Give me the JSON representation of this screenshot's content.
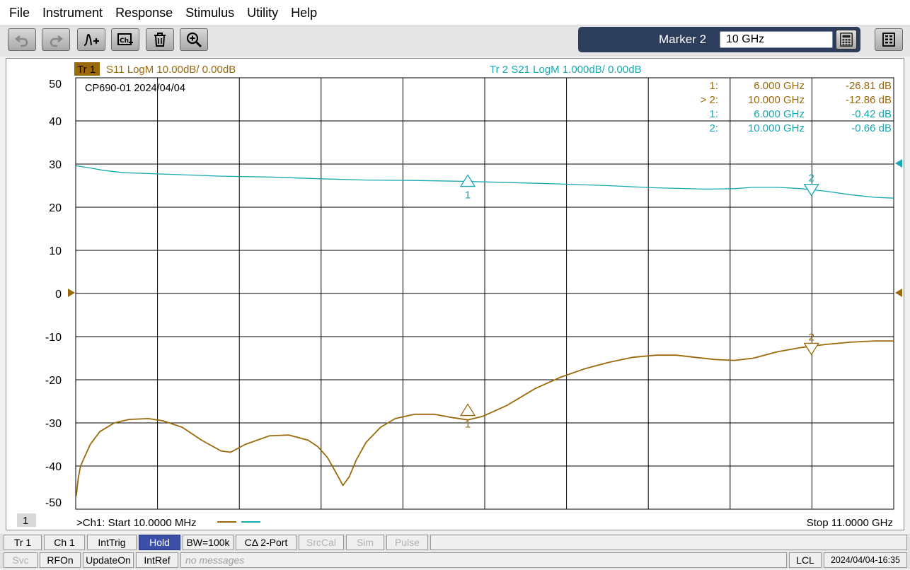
{
  "menu": [
    "File",
    "Instrument",
    "Response",
    "Stimulus",
    "Utility",
    "Help"
  ],
  "toolbar": {
    "buttons": [
      {
        "name": "undo-button",
        "icon": "undo-icon"
      },
      {
        "name": "redo-button",
        "icon": "redo-icon"
      },
      {
        "name": "add-trace-button",
        "icon": "add-trace-icon"
      },
      {
        "name": "add-channel-button",
        "icon": "add-channel-icon"
      },
      {
        "name": "delete-button",
        "icon": "trash-icon"
      },
      {
        "name": "zoom-button",
        "icon": "zoom-in-icon"
      }
    ],
    "marker_label": "Marker 2",
    "marker_value": "10 GHz",
    "keypad_icon": "calculator-icon",
    "menu_icon": "grid-menu-icon"
  },
  "colors": {
    "trace1": "#9a6a0a",
    "trace2": "#18a8b0",
    "grid": "#000000",
    "label_bg": "#9a6a0a"
  },
  "header": {
    "tr1_label": "Tr 1",
    "tr1_text": "S11 LogM 10.00dB/  0.00dB",
    "tr2_text": "Tr  2   S21 LogM 1.000dB/  0.00dB"
  },
  "annotation": "CP690-01  2024/04/04",
  "marker_table": [
    {
      "trace": 1,
      "id": "1:",
      "freq": "6.000  GHz",
      "val": "-26.81 dB"
    },
    {
      "trace": 1,
      "id": "> 2:",
      "freq": "10.000  GHz",
      "val": "-12.86 dB"
    },
    {
      "trace": 2,
      "id": "1:",
      "freq": "6.000  GHz",
      "val": "-0.42 dB"
    },
    {
      "trace": 2,
      "id": "2:",
      "freq": "10.000  GHz",
      "val": "-0.66 dB"
    }
  ],
  "footer": {
    "channel_number": "1",
    "start_text": ">Ch1:  Start   10.0000 MHz",
    "stop_text": "Stop  11.0000 GHz"
  },
  "chart_data": {
    "type": "line",
    "x_range_ghz": [
      0.01,
      11.0
    ],
    "x_divisions": 10,
    "y_ticks": [
      50,
      40,
      30,
      20,
      10,
      0,
      -10,
      -20,
      -30,
      -40,
      -50
    ],
    "y_range_db": [
      -50,
      50
    ],
    "grid": true,
    "series": [
      {
        "name": "S11 LogM",
        "scale_db_per_div": 10,
        "ref_db": 0,
        "points": [
          [
            0.01,
            -47
          ],
          [
            0.05,
            -43
          ],
          [
            0.1,
            -40
          ],
          [
            0.3,
            -35
          ],
          [
            0.5,
            -32
          ],
          [
            0.8,
            -30
          ],
          [
            1.1,
            -29.2
          ],
          [
            1.5,
            -29.0
          ],
          [
            1.8,
            -29.5
          ],
          [
            2.2,
            -31
          ],
          [
            2.6,
            -34
          ],
          [
            3.0,
            -36.5
          ],
          [
            3.2,
            -36.8
          ],
          [
            3.5,
            -35
          ],
          [
            4.0,
            -33
          ],
          [
            4.4,
            -32.8
          ],
          [
            4.8,
            -34
          ],
          [
            5.0,
            -35.5
          ],
          [
            5.2,
            -38
          ],
          [
            5.4,
            -42
          ],
          [
            5.52,
            -44.5
          ],
          [
            5.65,
            -42.5
          ],
          [
            5.8,
            -38.5
          ],
          [
            6.0,
            -34.5
          ],
          [
            6.3,
            -31
          ],
          [
            6.6,
            -29
          ],
          [
            7.0,
            -28
          ],
          [
            7.4,
            -28
          ],
          [
            7.8,
            -28.8
          ],
          [
            8.1,
            -29.3
          ],
          [
            8.4,
            -28.5
          ],
          [
            8.9,
            -26
          ],
          [
            9.5,
            -22
          ],
          [
            10.0,
            -19.5
          ],
          [
            10.5,
            -17.5
          ],
          [
            11.0,
            -16
          ],
          [
            11.5,
            -14.8
          ],
          [
            12.0,
            -14.3
          ],
          [
            12.4,
            -14.3
          ],
          [
            12.8,
            -14.8
          ],
          [
            13.2,
            -15.3
          ],
          [
            13.6,
            -15.5
          ],
          [
            14.0,
            -15.0
          ],
          [
            14.5,
            -13.5
          ],
          [
            15.0,
            -12.5
          ],
          [
            15.5,
            -11.8
          ],
          [
            16.0,
            -11.3
          ],
          [
            16.5,
            -11.0
          ],
          [
            16.9,
            -11.0
          ]
        ]
      },
      {
        "name": "S21 LogM",
        "scale_db_per_div": 1,
        "ref_db": 0,
        "points": [
          [
            0.01,
            29.6
          ],
          [
            0.3,
            29.1
          ],
          [
            0.6,
            28.5
          ],
          [
            1.0,
            28.0
          ],
          [
            2.0,
            27.6
          ],
          [
            3.0,
            27.2
          ],
          [
            4.0,
            27.0
          ],
          [
            5.0,
            26.6
          ],
          [
            6.0,
            26.3
          ],
          [
            7.0,
            26.2
          ],
          [
            8.0,
            26.0
          ],
          [
            9.0,
            25.7
          ],
          [
            10.0,
            25.4
          ],
          [
            11.0,
            25.0
          ],
          [
            12.0,
            24.5
          ],
          [
            13.0,
            24.2
          ],
          [
            13.6,
            24.3
          ],
          [
            14.0,
            24.6
          ],
          [
            14.5,
            24.6
          ],
          [
            15.0,
            24.3
          ],
          [
            15.5,
            23.7
          ],
          [
            16.0,
            22.9
          ],
          [
            16.5,
            22.3
          ],
          [
            16.9,
            22.1
          ]
        ]
      }
    ],
    "markers": [
      {
        "trace": "S11",
        "label": "1",
        "x": 8.1,
        "y": -26.81
      },
      {
        "trace": "S11",
        "label": "2",
        "x": 15.2,
        "y": -12.86
      },
      {
        "trace": "S21",
        "label": "1",
        "x": 8.1,
        "y": 26.3
      },
      {
        "trace": "S21",
        "label": "2",
        "x": 15.2,
        "y": 24.0
      }
    ]
  },
  "status1": [
    {
      "label": "Tr 1",
      "state": "normal"
    },
    {
      "label": "Ch 1",
      "state": "normal"
    },
    {
      "label": "IntTrig",
      "state": "normal"
    },
    {
      "label": "Hold",
      "state": "active"
    },
    {
      "label": "BW=100k",
      "state": "normal"
    },
    {
      "label": "CΔ 2-Port",
      "state": "normal"
    },
    {
      "label": "SrcCal",
      "state": "dim"
    },
    {
      "label": "Sim",
      "state": "dim"
    },
    {
      "label": "Pulse",
      "state": "dim"
    }
  ],
  "status2": [
    {
      "label": "Svc",
      "state": "dim"
    },
    {
      "label": "RFOn",
      "state": "normal"
    },
    {
      "label": "UpdateOn",
      "state": "normal"
    },
    {
      "label": "IntRef",
      "state": "normal"
    },
    {
      "label": "no messages",
      "state": "msg"
    },
    {
      "label": "LCL",
      "state": "normal"
    },
    {
      "label": "2024/04/04-16:35",
      "state": "normal"
    }
  ]
}
